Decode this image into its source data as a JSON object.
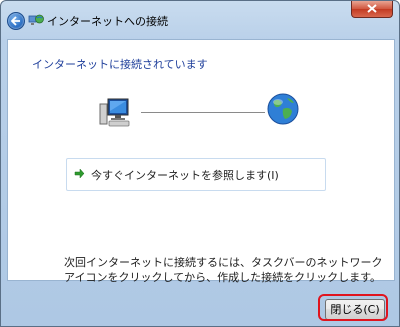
{
  "window": {
    "title": "インターネットへの接続",
    "icons": {
      "back": "back-arrow-icon",
      "title": "network-connection-icon",
      "close": "close-icon"
    },
    "accent_color": "#1f3f9b",
    "close_button_color": "#c23a22"
  },
  "content": {
    "heading": "インターネットに接続されています",
    "diagram_icons": {
      "computer": "computer-icon",
      "internet": "globe-icon"
    },
    "browse_link": "今すぐインターネットを参照します(I)",
    "browse_link_icon": "green-arrow-icon",
    "info_lines": [
      "次回インターネットに接続するには、タスクバーのネットワーク",
      "アイコンをクリックしてから、作成した接続をクリックします。"
    ]
  },
  "footer": {
    "close_label": "閉じる(C)",
    "highlight_color": "#e0141e"
  }
}
